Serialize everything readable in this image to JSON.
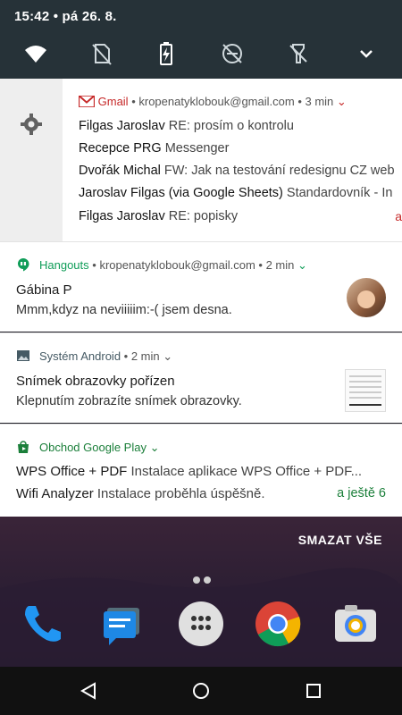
{
  "status_bar": {
    "time_date": "15:42 • pá 26. 8."
  },
  "quick_settings": [
    "wifi-icon",
    "no-sim-icon",
    "battery-charging-icon",
    "do-not-disturb-off-icon",
    "flashlight-off-icon",
    "expand-icon"
  ],
  "gmail": {
    "app": "Gmail",
    "account": "kropenatyklobouk@gmail.com",
    "time": "3 min",
    "messages": [
      {
        "from": "Filgas Jaroslav",
        "subject": "RE: prosím o kontrolu"
      },
      {
        "from": "Recepce PRG",
        "subject": "Messenger"
      },
      {
        "from": "Dvořák Michal",
        "subject": "FW: Jak na testování redesignu CZ web"
      },
      {
        "from": "Jaroslav Filgas (via Google Sheets)",
        "subject": "Standardovník - In"
      },
      {
        "from": "Filgas Jaroslav",
        "subject": "RE: popisky"
      }
    ],
    "more": "a",
    "colors": {
      "accent": "#c62828"
    }
  },
  "hangouts": {
    "app": "Hangouts",
    "account": "kropenatyklobouk@gmail.com",
    "time": "2 min",
    "title": "Gábina P",
    "text": "Mmm,kdyz na neviiiiim:-( jsem desna.",
    "color": "#0f9d58"
  },
  "android": {
    "app": "Systém Android",
    "time": "2 min",
    "title": "Snímek obrazovky pořízen",
    "text": "Klepnutím zobrazíte snímek obrazovky.",
    "color": "#455a64"
  },
  "play": {
    "app": "Obchod Google Play",
    "items": [
      {
        "title": "WPS Office + PDF",
        "text": "Instalace aplikace WPS Office + PDF..."
      },
      {
        "title": "Wifi Analyzer",
        "text": "Instalace proběhla úspěšně."
      }
    ],
    "more": "a ještě 6",
    "color": "#1b7f3a"
  },
  "clear_all": "SMAZAT VŠE",
  "dock": [
    "phone-icon",
    "messages-icon",
    "app-drawer-icon",
    "chrome-icon",
    "camera-icon"
  ],
  "nav": [
    "back-icon",
    "home-icon",
    "recents-icon"
  ]
}
